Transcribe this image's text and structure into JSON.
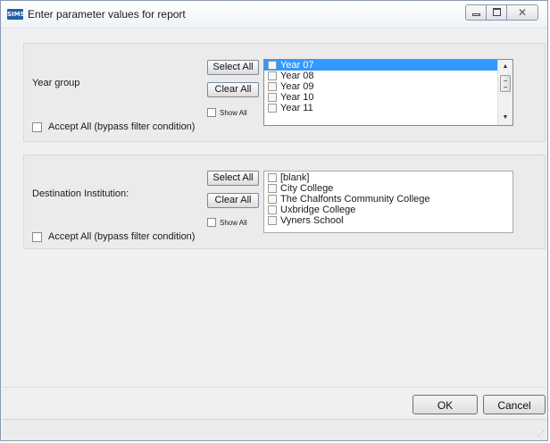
{
  "window": {
    "app_icon_text": "SIMS",
    "title": "Enter parameter values for report",
    "icons": {
      "minimize": "minimize-icon",
      "maximize": "maximize-icon",
      "close": "close-icon"
    }
  },
  "year_group": {
    "label": "Year group",
    "select_all": "Select All",
    "clear_all": "Clear All",
    "show_all": "Show All",
    "accept_all": "Accept All (bypass filter condition)",
    "items": [
      "Year 07",
      "Year 08",
      "Year 09",
      "Year 10",
      "Year 11"
    ],
    "selected_index": 0
  },
  "destination": {
    "label": "Destination Institution:",
    "select_all": "Select All",
    "clear_all": "Clear All",
    "show_all": "Show All",
    "accept_all": "Accept All (bypass filter condition)",
    "items": [
      "[blank]",
      "City College",
      "The Chalfonts Community College",
      "Uxbridge College",
      "Vyners School"
    ]
  },
  "footer": {
    "ok": "OK",
    "cancel": "Cancel"
  },
  "colors": {
    "selection": "#3399ff",
    "group_bg": "#ebebeb",
    "app_icon": "#1f5fa8"
  }
}
